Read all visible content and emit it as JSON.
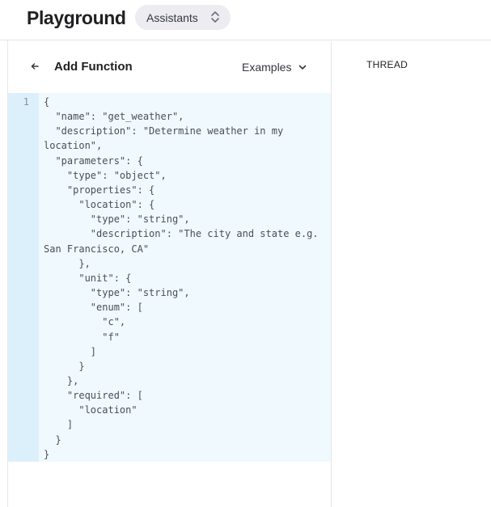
{
  "header": {
    "title": "Playground",
    "mode_select": {
      "value": "Assistants",
      "icon": "chevron-up-down-icon"
    }
  },
  "function_panel": {
    "back_icon": "arrow-left-icon",
    "title": "Add Function",
    "examples_label": "Examples",
    "examples_icon": "chevron-down-icon",
    "editor": {
      "line_numbers": [
        "1"
      ],
      "lines": [
        "{",
        "  \"name\": \"get_weather\",",
        "  \"description\": \"Determine weather in my",
        "location\",",
        "  \"parameters\": {",
        "    \"type\": \"object\",",
        "    \"properties\": {",
        "      \"location\": {",
        "        \"type\": \"string\",",
        "        \"description\": \"The city and state e.g.",
        "San Francisco, CA\"",
        "      },",
        "      \"unit\": {",
        "        \"type\": \"string\",",
        "        \"enum\": [",
        "          \"c\",",
        "          \"f\"",
        "        ]",
        "      }",
        "    },",
        "    \"required\": [",
        "      \"location\"",
        "    ]",
        "  }",
        "}"
      ]
    }
  },
  "thread_panel": {
    "label": "THREAD"
  },
  "colors": {
    "editor_background": "#f0f9fd",
    "gutter_background": "#dcf0fb",
    "select_background": "#ececf1",
    "text": "#202123"
  }
}
